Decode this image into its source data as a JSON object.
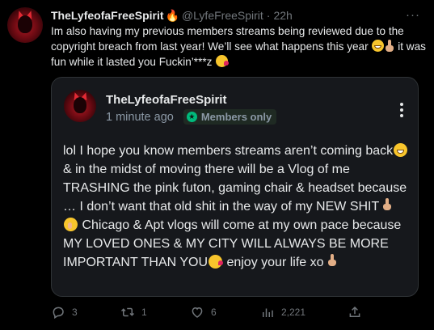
{
  "tweet": {
    "display_name": "TheLyfeofaFreeSpirit",
    "handle": "@LyfeFreeSpirit",
    "separator": "·",
    "time": "22h",
    "more": "···",
    "text_1": "Im also having my previous members streams being reviewed due to the copyright breach from last year! We’ll see what happens this year ",
    "text_2": " it was fun while it lasted you Fuckin’***z "
  },
  "quote": {
    "display_name": "TheLyfeofaFreeSpirit",
    "time": "1 minute ago",
    "badge": "Members only",
    "text_1": "lol I hope you know members streams aren’t coming back",
    "text_2": " & in the midst of moving there will be a Vlog of me TRASHING the pink futon, gaming chair & headset because … I don’t want that old shit in the way of my NEW SHIT ",
    "text_3": " Chicago & Apt vlogs will come at my own pace because MY LOVED ONES & MY CITY WILL ALWAYS BE MORE IMPORTANT THAN YOU",
    "text_4": " enjoy your life xo "
  },
  "actions": {
    "replies": "3",
    "retweets": "1",
    "likes": "6",
    "views": "2,221"
  },
  "icons": {
    "fire": "fire-icon",
    "members": "star-icon",
    "reply": "reply-icon",
    "retweet": "retweet-icon",
    "like": "heart-icon",
    "views": "views-icon",
    "share": "share-icon"
  },
  "colors": {
    "background": "#000000",
    "card": "#16181c",
    "muted": "#71767b",
    "members_green": "#00ba7c"
  }
}
